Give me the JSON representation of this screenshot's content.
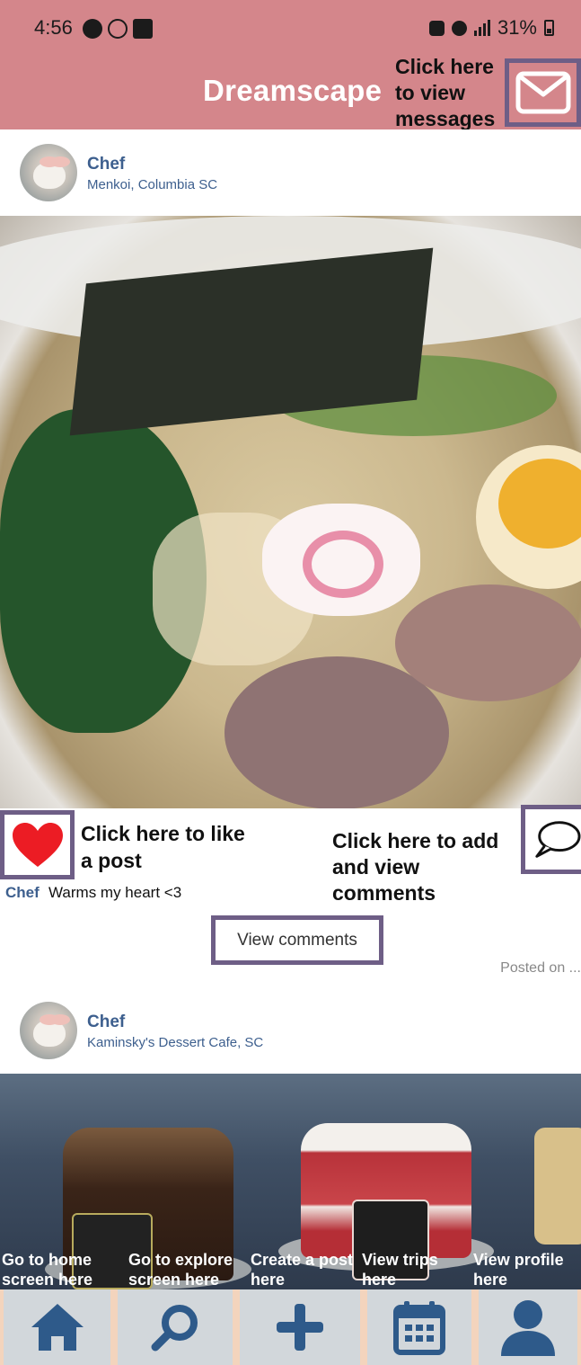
{
  "status_bar": {
    "time": "4:56",
    "battery": "31%"
  },
  "header": {
    "title": "Dreamscape",
    "messages_hint": "Click here to view messages",
    "messages_icon": "mail-icon"
  },
  "posts": [
    {
      "user": "Chef",
      "location": "Menkoi, Columbia SC",
      "image_alt": "ramen",
      "caption_user": "Chef",
      "caption": "Warms my heart <3",
      "view_comments_label": "View comments",
      "posted_on": "Posted on ..."
    },
    {
      "user": "Chef",
      "location": "Kaminsky's Dessert Cafe, SC"
    }
  ],
  "hints": {
    "like": "Click here to like a post",
    "comment": "Click here to add and view comments"
  },
  "icons": {
    "like": "heart-icon",
    "comment": "speech-bubble-icon"
  },
  "colors": {
    "header": "#d4868b",
    "outline": "#6e5e86",
    "username": "#3d5f8e",
    "nav_icon": "#2e5a8a",
    "heart": "#ec1c24"
  },
  "bottom_nav": [
    {
      "hint": "Go to home screen here",
      "icon": "home-icon"
    },
    {
      "hint": "Go to explore screen here",
      "icon": "search-icon"
    },
    {
      "hint": "Create a post here",
      "icon": "plus-icon"
    },
    {
      "hint": "View trips here",
      "icon": "calendar-icon"
    },
    {
      "hint": "View profile here",
      "icon": "profile-icon"
    }
  ]
}
